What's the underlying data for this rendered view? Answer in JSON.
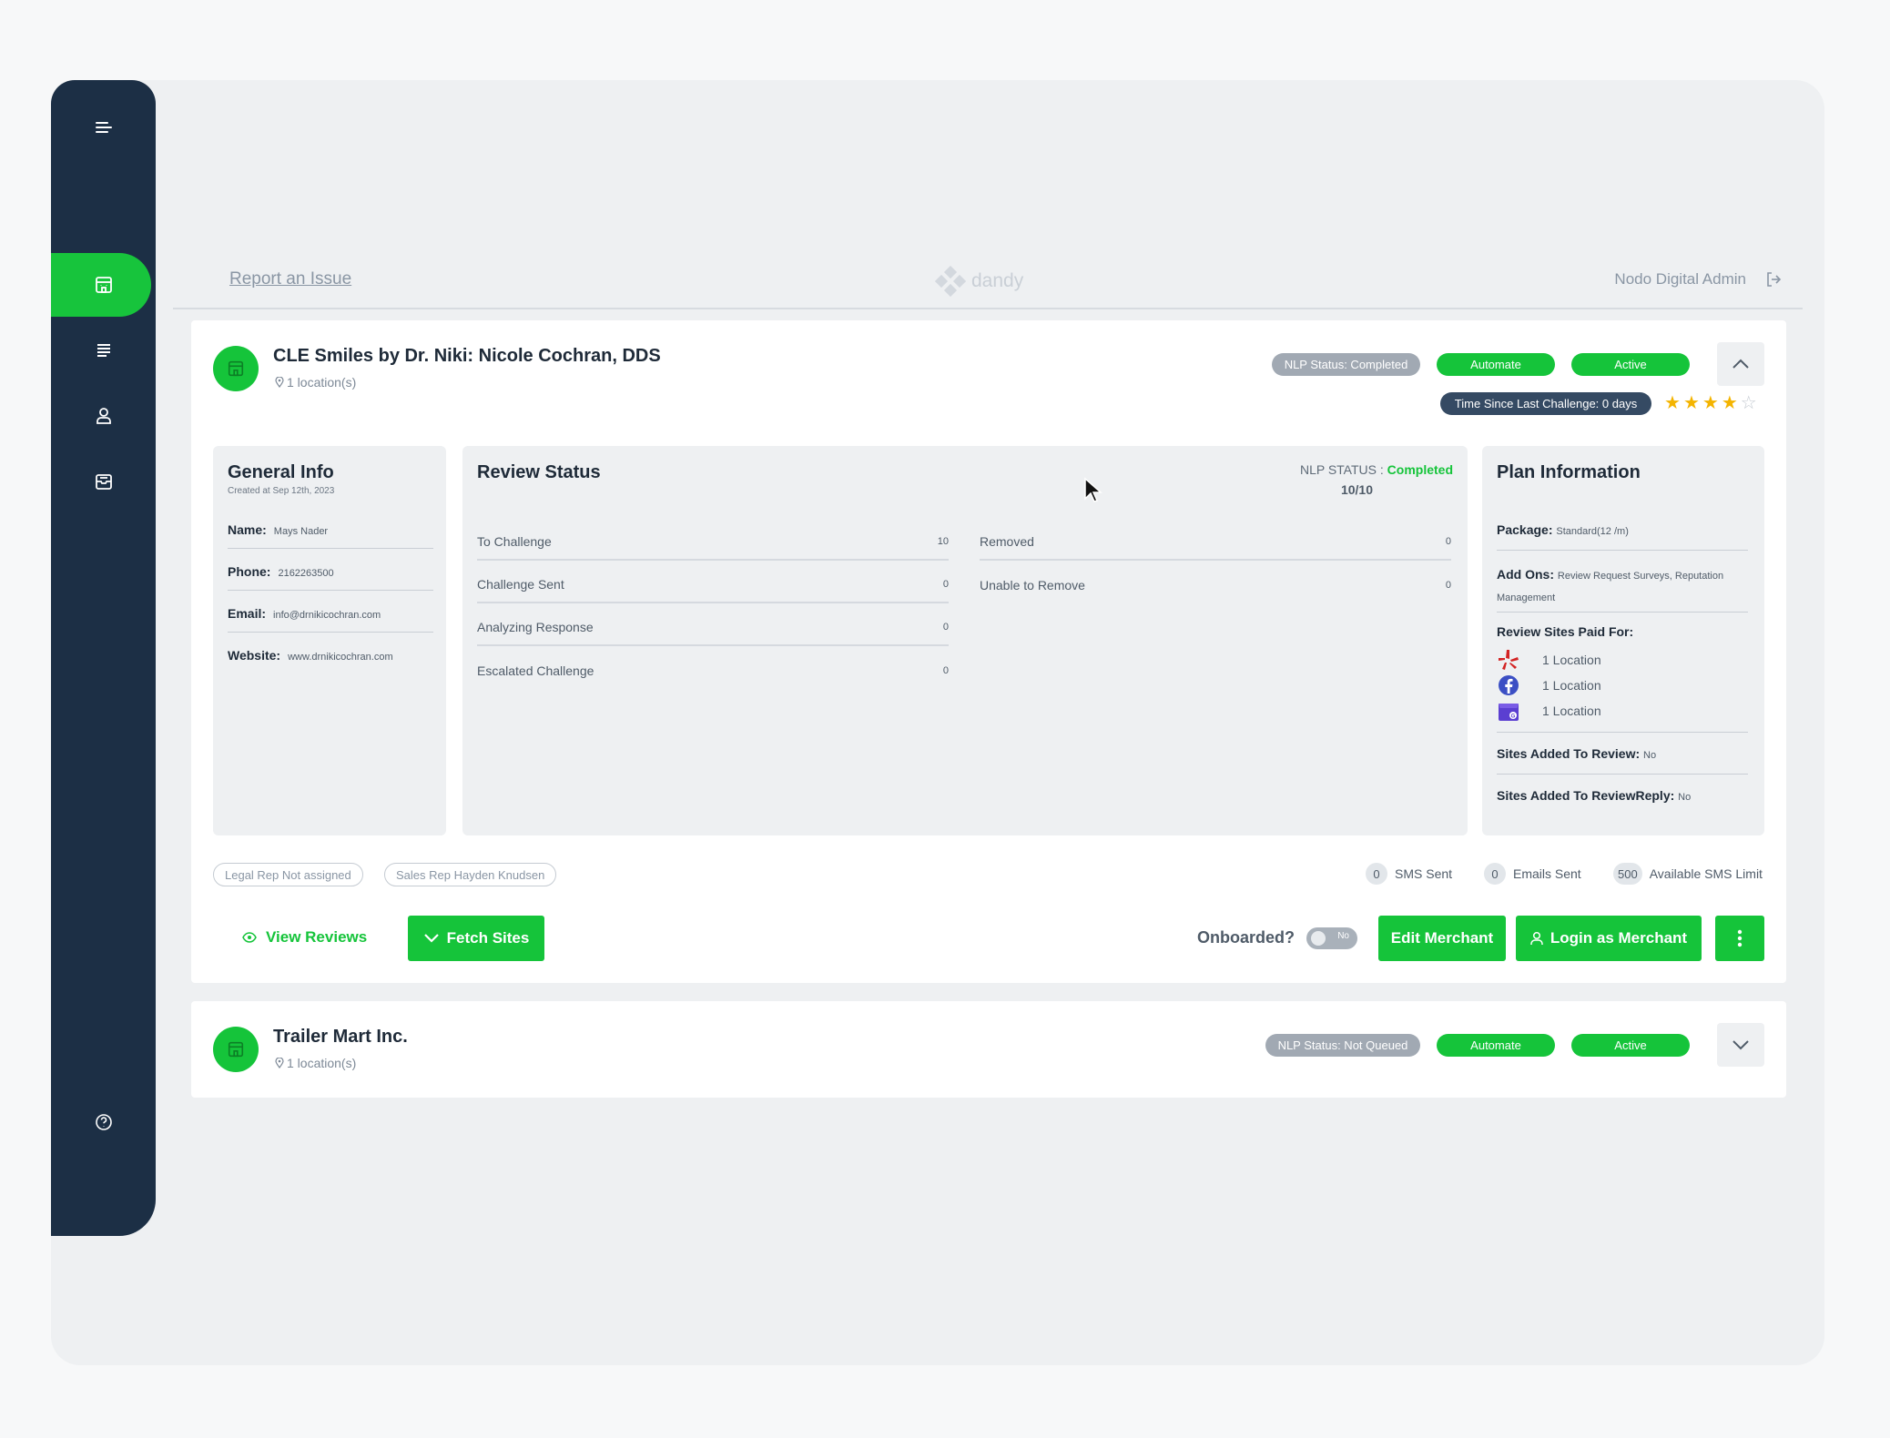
{
  "topbar": {
    "report_link": "Report an Issue",
    "brand": "dandy",
    "admin_name": "Nodo Digital Admin"
  },
  "sidebar": {
    "items": [
      {
        "name": "menu",
        "icon": "menu-icon"
      },
      {
        "name": "merchants",
        "icon": "building-icon",
        "active": true
      },
      {
        "name": "list",
        "icon": "list-icon"
      },
      {
        "name": "users",
        "icon": "user-icon"
      },
      {
        "name": "inbox",
        "icon": "inbox-icon"
      },
      {
        "name": "help",
        "icon": "help-circle-icon"
      }
    ]
  },
  "merchant1": {
    "name": "CLE Smiles by Dr. Niki: Nicole Cochran, DDS",
    "locations": "1 location(s)",
    "nlp_pill": "NLP Status: Completed",
    "automate_pill": "Automate",
    "active_pill": "Active",
    "time_pill": "Time Since Last Challenge: 0 days",
    "rating": 4,
    "rating_max": 5,
    "general": {
      "title": "General Info",
      "created": "Created at Sep 12th, 2023",
      "name_label": "Name:",
      "name_value": "Mays Nader",
      "phone_label": "Phone:",
      "phone_value": "2162263500",
      "email_label": "Email:",
      "email_value": "info@drnikicochran.com",
      "website_label": "Website:",
      "website_value": "www.drnikicochran.com"
    },
    "review": {
      "title": "Review Status",
      "nlp_label": "NLP STATUS : ",
      "nlp_value": "Completed",
      "nlp_score": "10/10",
      "left": [
        {
          "label": "To Challenge",
          "value": "10"
        },
        {
          "label": "Challenge Sent",
          "value": "0"
        },
        {
          "label": "Analyzing Response",
          "value": "0"
        },
        {
          "label": "Escalated Challenge",
          "value": "0"
        }
      ],
      "right": [
        {
          "label": "Removed",
          "value": "0"
        },
        {
          "label": "Unable to Remove",
          "value": "0"
        }
      ]
    },
    "plan": {
      "title": "Plan Information",
      "package_label": "Package:",
      "package_value": "Standard(12 /m)",
      "addons_label": "Add Ons:",
      "addons_value": "Review Request Surveys, Reputation Management",
      "sites_label": "Review Sites Paid For:",
      "sites": [
        {
          "icon": "yelp-icon",
          "color": "#d32323",
          "count": "1 Location"
        },
        {
          "icon": "facebook-icon",
          "color": "#3b4fc4",
          "count": "1 Location"
        },
        {
          "icon": "google-business-icon",
          "color": "#5b3fd1",
          "count": "1 Location"
        }
      ],
      "sites_added_review_label": "Sites Added To Review:",
      "sites_added_review_value": "No",
      "sites_added_reply_label": "Sites Added To ReviewReply:",
      "sites_added_reply_value": "No"
    },
    "legal_rep": "Legal Rep Not assigned",
    "sales_rep": "Sales Rep Hayden Knudsen",
    "sms_sent_count": "0",
    "sms_sent_label": "SMS Sent",
    "emails_sent_count": "0",
    "emails_sent_label": "Emails Sent",
    "sms_limit_count": "500",
    "sms_limit_label": "Available SMS Limit",
    "view_reviews": "View Reviews",
    "fetch_sites": "Fetch Sites",
    "onboarded_label": "Onboarded?",
    "onboarded_value": "No",
    "edit_merchant": "Edit Merchant",
    "login_merchant": "Login as Merchant"
  },
  "merchant2": {
    "name": "Trailer Mart Inc.",
    "locations": "1 location(s)",
    "nlp_pill": "NLP Status: Not Queued",
    "automate_pill": "Automate",
    "active_pill": "Active"
  },
  "colors": {
    "accent": "#15c43a",
    "sidebar": "#1c2f45"
  }
}
